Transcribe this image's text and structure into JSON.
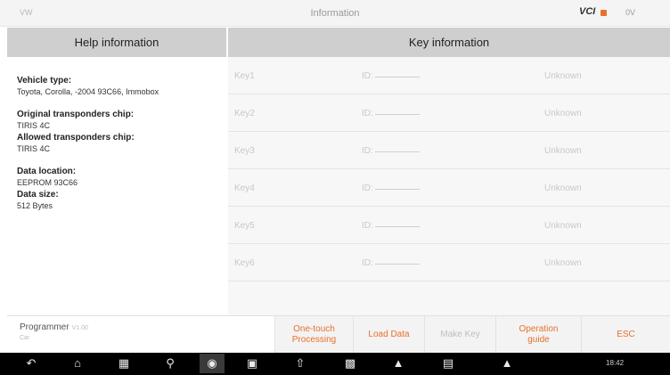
{
  "topbar": {
    "left": "VW",
    "title": "Information",
    "vci": "VCI",
    "voltage": "0V"
  },
  "headers": {
    "help": "Help information",
    "key": "Key information"
  },
  "help": {
    "vehicle_type_label": "Vehicle type:",
    "vehicle_type_value": "Toyota, Corolla, -2004 93C66, Immobox",
    "orig_chip_label": "Original transponders chip:",
    "orig_chip_value": "TIRIS 4C",
    "allowed_chip_label": "Allowed transponders chip:",
    "allowed_chip_value": "TIRIS 4C",
    "data_location_label": "Data location:",
    "data_location_value": "EEPROM 93C66",
    "data_size_label": "Data size:",
    "data_size_value": "512 Bytes"
  },
  "keys": [
    {
      "key": "Key1",
      "id": "ID:",
      "status": "Unknown"
    },
    {
      "key": "Key2",
      "id": "ID:",
      "status": "Unknown"
    },
    {
      "key": "Key3",
      "id": "ID:",
      "status": "Unknown"
    },
    {
      "key": "Key4",
      "id": "ID:",
      "status": "Unknown"
    },
    {
      "key": "Key5",
      "id": "ID:",
      "status": "Unknown"
    },
    {
      "key": "Key6",
      "id": "ID:",
      "status": "Unknown"
    }
  ],
  "toolbar": {
    "programmer": "Programmer",
    "programmer_version": "V1.00",
    "programmer_sub": "Car",
    "one_touch_1": "One-touch",
    "one_touch_2": "Processing",
    "load_data": "Load Data",
    "make_key": "Make Key",
    "operation_1": "Operation",
    "operation_2": "guide",
    "esc": "ESC"
  },
  "navbar": {
    "icons": [
      "back-icon",
      "home-icon",
      "recents-icon",
      "search-icon",
      "camera-icon",
      "image-icon",
      "upload-icon",
      "vci-icon",
      "gas-icon",
      "car-icon",
      "battery-car-icon"
    ],
    "clock": "18:42"
  },
  "colors": {
    "accent": "#e8702a",
    "header_bg": "#cfcfcf",
    "disabled": "#bdbdbd"
  }
}
